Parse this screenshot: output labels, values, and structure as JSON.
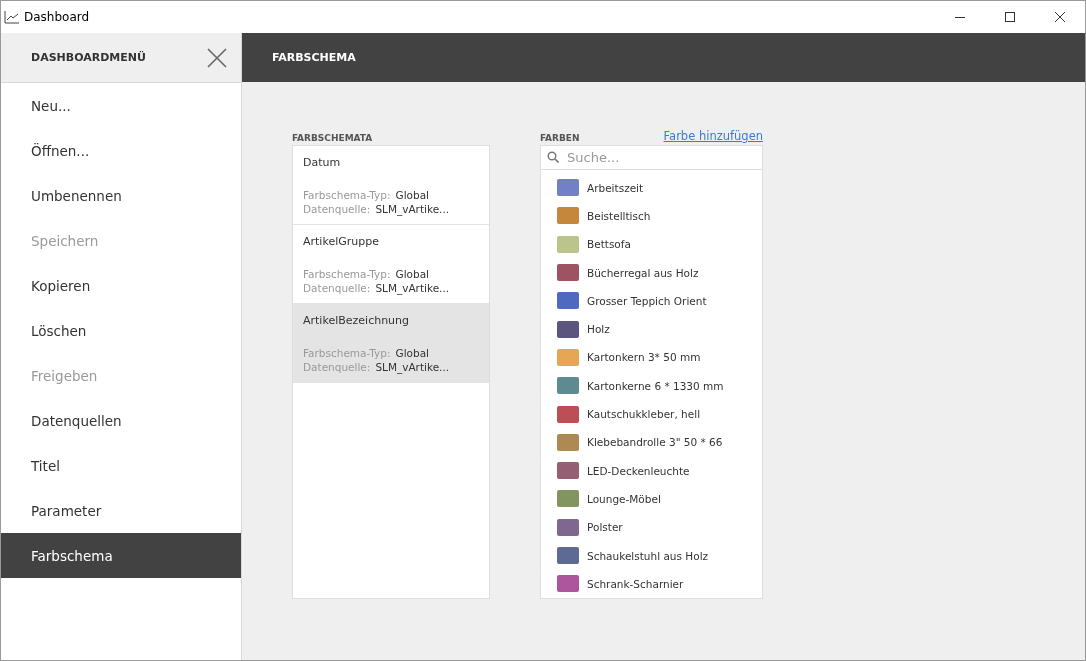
{
  "window": {
    "title": "Dashboard"
  },
  "sidebar": {
    "title": "DASHBOARDMENÜ",
    "items": [
      {
        "label": "Neu...",
        "disabled": false,
        "selected": false
      },
      {
        "label": "Öffnen...",
        "disabled": false,
        "selected": false
      },
      {
        "label": "Umbenennen",
        "disabled": false,
        "selected": false
      },
      {
        "label": "Speichern",
        "disabled": true,
        "selected": false
      },
      {
        "label": "Kopieren",
        "disabled": false,
        "selected": false
      },
      {
        "label": "Löschen",
        "disabled": false,
        "selected": false
      },
      {
        "label": "Freigeben",
        "disabled": true,
        "selected": false
      },
      {
        "label": "Datenquellen",
        "disabled": false,
        "selected": false
      },
      {
        "label": "Titel",
        "disabled": false,
        "selected": false
      },
      {
        "label": "Parameter",
        "disabled": false,
        "selected": false
      },
      {
        "label": "Farbschema",
        "disabled": false,
        "selected": true
      }
    ]
  },
  "header": {
    "title": "FARBSCHEMA"
  },
  "schemes": {
    "label": "FARBSCHEMATA",
    "items": [
      {
        "name": "Datum",
        "type_label": "Farbschema-Typ:",
        "type": "Global",
        "source_label": "Datenquelle:",
        "source": "SLM_vArtike...",
        "selected": false
      },
      {
        "name": "ArtikelGruppe",
        "type_label": "Farbschema-Typ:",
        "type": "Global",
        "source_label": "Datenquelle:",
        "source": "SLM_vArtike...",
        "selected": false
      },
      {
        "name": "ArtikelBezeichnung",
        "type_label": "Farbschema-Typ:",
        "type": "Global",
        "source_label": "Datenquelle:",
        "source": "SLM_vArtike...",
        "selected": true
      }
    ]
  },
  "colors": {
    "label": "FARBEN",
    "add_link": "Farbe hinzufügen",
    "search": {
      "placeholder": "Suche..."
    },
    "items": [
      {
        "name": "Arbeitszeit",
        "color": "#7280c8"
      },
      {
        "name": "Beistelltisch",
        "color": "#c5873c"
      },
      {
        "name": "Bettsofa",
        "color": "#bbc48a"
      },
      {
        "name": "Bücherregal aus Holz",
        "color": "#9e5363"
      },
      {
        "name": "Grosser Teppich Orient",
        "color": "#5069c0"
      },
      {
        "name": "Holz",
        "color": "#5c567e"
      },
      {
        "name": "Kartonkern 3* 50 mm",
        "color": "#e6a752"
      },
      {
        "name": "Kartonkerne 6 * 1330 mm",
        "color": "#5e8b92"
      },
      {
        "name": "Kautschukkleber, hell",
        "color": "#bd4e55"
      },
      {
        "name": "Klebebandrolle 3\" 50 * 66",
        "color": "#ad8a52"
      },
      {
        "name": "LED-Deckenleuchte",
        "color": "#955e72"
      },
      {
        "name": "Lounge-Möbel",
        "color": "#82945f"
      },
      {
        "name": "Polster",
        "color": "#7e6890"
      },
      {
        "name": "Schaukelstuhl aus Holz",
        "color": "#5c6a94"
      },
      {
        "name": "Schrank-Scharnier",
        "color": "#ad569e"
      }
    ]
  }
}
